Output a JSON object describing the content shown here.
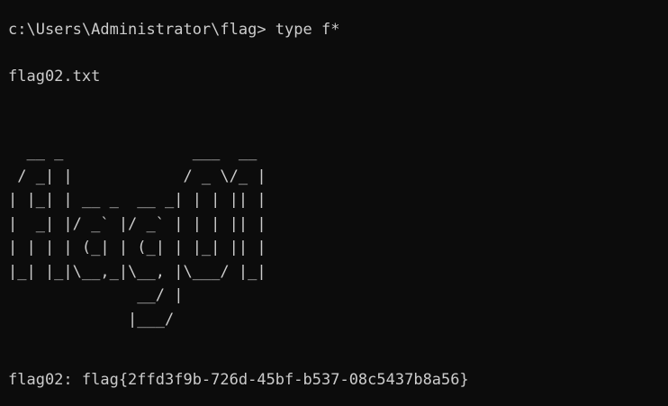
{
  "terminal": {
    "prompt_line": "c:\\Users\\Administrator\\flag> type f*",
    "filename": "flag02.txt",
    "ascii_art": "  __ _              ___  __\n / _| |            / _ \\/_ |\n| |_| | __ _  __ _| | | || |\n|  _| |/ _` |/ _` | | | || |\n| | | | (_| | (_| | |_| || |\n|_| |_|\\__,_|\\__, |\\___/ |_|\n              __/ |\n             |___/",
    "flag_line": "flag02: flag{2ffd3f9b-726d-45bf-b537-08c5437b8a56}"
  },
  "colors": {
    "background": "#0c0c0c",
    "foreground": "#cccccc"
  }
}
